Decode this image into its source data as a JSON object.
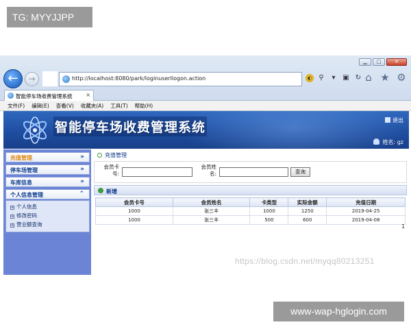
{
  "overlays": {
    "top_tag": "TG: MYYJJPP",
    "bottom_tag": "www-wap-hglogin.com",
    "watermark": "https://blog.csdn.net/myqq80213251"
  },
  "browser": {
    "window_buttons": [
      "▁",
      "□",
      "✕"
    ],
    "address": "http://localhost:8080/park/loginuserllogon.action",
    "tab_title": "智能停车场收费管理系统",
    "tab_close": "×",
    "menus": [
      "文件(F)",
      "编辑(E)",
      "查看(V)",
      "收藏夹(A)",
      "工具(T)",
      "帮助(H)"
    ]
  },
  "banner": {
    "title": "智能停车场收费管理系统",
    "exit_label": "退出",
    "user_label": "姓名: gz"
  },
  "sidebar": {
    "items": [
      {
        "label": "充值管理",
        "arrow": "»"
      },
      {
        "label": "停车场管理",
        "arrow": "»"
      },
      {
        "label": "车库信息",
        "arrow": "»"
      },
      {
        "label": "个人信息管理",
        "arrow": "⌃"
      }
    ],
    "sub_links": [
      "个人信息",
      "修改密码",
      "营业额查询"
    ]
  },
  "main": {
    "breadcrumb": "充值管理",
    "search": {
      "card_label_1": "会员卡",
      "card_label_2": "号:",
      "name_label_1": "会员姓",
      "name_label_2": "名:",
      "card_value": "",
      "name_value": "",
      "button": "查询"
    },
    "list_title": "新增",
    "columns": [
      "会员卡号",
      "会员姓名",
      "卡类型",
      "实际金额",
      "充值日期"
    ],
    "rows": [
      [
        "1000",
        "张三丰",
        "1000",
        "1250",
        "2019-04-25"
      ],
      [
        "1000",
        "张三丰",
        "500",
        "600",
        "2019-04-08"
      ]
    ],
    "pager": "1"
  }
}
